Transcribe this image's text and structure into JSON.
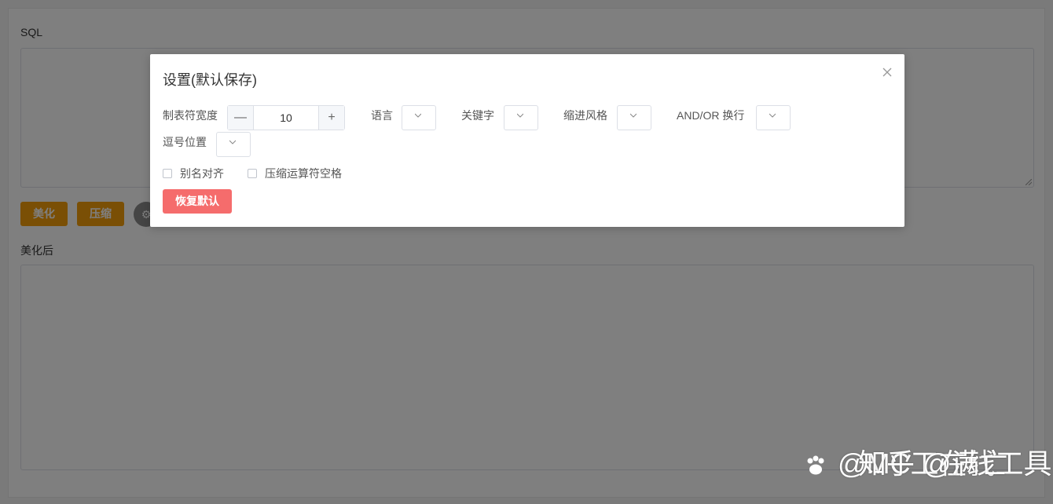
{
  "page": {
    "sql_label": "SQL",
    "beautify_button": "美化",
    "compress_button": "压缩",
    "result_label": "美化后"
  },
  "modal": {
    "title": "设置(默认保存)",
    "close_icon": "close-icon",
    "fields": {
      "tab_width": {
        "label": "制表符宽度",
        "value": "10",
        "minus": "—",
        "plus": "+"
      },
      "language": {
        "label": "语言"
      },
      "keyword": {
        "label": "关键字"
      },
      "indent_style": {
        "label": "缩进风格"
      },
      "and_or_newline": {
        "label": "AND/OR 换行"
      },
      "comma_position": {
        "label": "逗号位置"
      }
    },
    "checkboxes": {
      "alias_align": "别名对齐",
      "compress_operator_space": "压缩运算符空格"
    },
    "reset_button": "恢复默认"
  },
  "watermark": {
    "text": "@MC工在线工具",
    "overlay_text": "知乎 @满亡"
  },
  "colors": {
    "accent_orange": "#f59e0b",
    "danger": "#f56c6c",
    "overlay": "rgba(0,0,0,0.5)"
  }
}
